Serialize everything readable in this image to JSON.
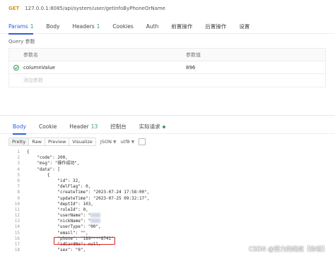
{
  "request": {
    "method": "GET",
    "url": "127.0.0.1:8085/api/system/user/getInfoByPhoneOrName"
  },
  "request_tabs": [
    {
      "label": "Params",
      "count": "1",
      "active": true
    },
    {
      "label": "Body",
      "count": "",
      "active": false
    },
    {
      "label": "Headers",
      "count": "1",
      "active": false
    },
    {
      "label": "Cookies",
      "count": "",
      "active": false
    },
    {
      "label": "Auth",
      "count": "",
      "active": false
    },
    {
      "label": "前置操作",
      "count": "",
      "active": false
    },
    {
      "label": "后置操作",
      "count": "",
      "active": false
    },
    {
      "label": "设置",
      "count": "",
      "active": false
    }
  ],
  "query": {
    "label": "Query 参数",
    "col_name": "参数名",
    "col_value": "参数值",
    "rows": [
      {
        "name": "columnValue",
        "value": "896",
        "checked": true
      }
    ],
    "add_placeholder": "添加参数"
  },
  "response_tabs": [
    {
      "label": "Body",
      "count": "",
      "active": true,
      "dot": false
    },
    {
      "label": "Cookie",
      "count": "",
      "active": false,
      "dot": false
    },
    {
      "label": "Header",
      "count": "13",
      "active": false,
      "dot": false
    },
    {
      "label": "控制台",
      "count": "",
      "active": false,
      "dot": false
    },
    {
      "label": "实际请求",
      "count": "",
      "active": false,
      "dot": true
    }
  ],
  "toolbar": {
    "modes": [
      "Pretty",
      "Raw",
      "Preview",
      "Visualize"
    ],
    "active_mode": "Pretty",
    "format": "JSON",
    "encoding": "utf8"
  },
  "code_lines": [
    {
      "n": "1",
      "t": "{"
    },
    {
      "n": "2",
      "t": "    \"code\": 200,"
    },
    {
      "n": "3",
      "t": "    \"msg\": \"操作成功\","
    },
    {
      "n": "4",
      "t": "    \"data\": ["
    },
    {
      "n": "5",
      "t": "        {"
    },
    {
      "n": "6",
      "t": "            \"id\": 32,"
    },
    {
      "n": "7",
      "t": "            \"delFlag\": 0,"
    },
    {
      "n": "8",
      "t": "            \"createTime\": \"2023-07-24 17:58:00\","
    },
    {
      "n": "9",
      "t": "            \"updateTime\": \"2023-07-25 09:32:17\","
    },
    {
      "n": "10",
      "t": "            \"deptId\": 103,"
    },
    {
      "n": "11",
      "t": "            \"roleId\": 0,"
    },
    {
      "n": "12",
      "t": "            \"userName\": \""
    },
    {
      "n": "13",
      "t": "            \"nickName\": \""
    },
    {
      "n": "14",
      "t": "            \"userType\": \"00\","
    },
    {
      "n": "15",
      "t": "            \"email\": \"\","
    },
    {
      "n": "16",
      "t": "            \"phone\": \"189****8741\","
    },
    {
      "n": "17",
      "t": "            \"idCardNo\": null,"
    },
    {
      "n": "18",
      "t": "            \"sex\": \"0\","
    }
  ],
  "watermark": "CSDN @努力的蚂蚁【你若】"
}
